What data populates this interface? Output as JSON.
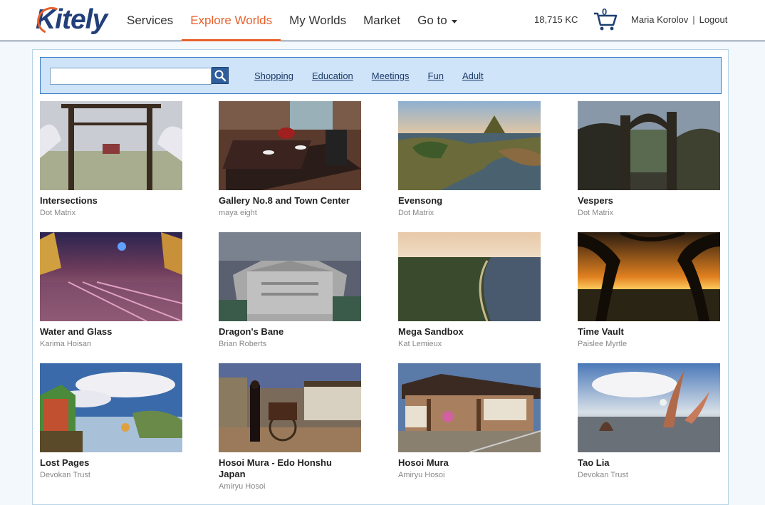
{
  "brand": {
    "logo_text": "Kitely"
  },
  "nav": {
    "items": [
      {
        "label": "Services"
      },
      {
        "label": "Explore Worlds"
      },
      {
        "label": "My Worlds"
      },
      {
        "label": "Market"
      },
      {
        "label": "Go to"
      }
    ],
    "active": "Explore Worlds"
  },
  "account": {
    "balance": "18,715 KC",
    "cart_count": "0",
    "user_name": "Maria Korolov",
    "separator": "|",
    "logout_label": "Logout"
  },
  "search": {
    "value": "",
    "placeholder": "",
    "categories": [
      "Shopping",
      "Education",
      "Meetings",
      "Fun",
      "Adult"
    ]
  },
  "worlds": [
    {
      "title": "Intersections",
      "owner": "Dot Matrix"
    },
    {
      "title": "Gallery No.8 and Town Center",
      "owner": "maya eight"
    },
    {
      "title": "Evensong",
      "owner": "Dot Matrix"
    },
    {
      "title": "Vespers",
      "owner": "Dot Matrix"
    },
    {
      "title": "Water and Glass",
      "owner": "Karima Hoisan"
    },
    {
      "title": "Dragon's Bane",
      "owner": "Brian Roberts"
    },
    {
      "title": "Mega Sandbox",
      "owner": "Kat Lemieux"
    },
    {
      "title": "Time Vault",
      "owner": "Paislee Myrtle"
    },
    {
      "title": "Lost Pages",
      "owner": "Devokan Trust"
    },
    {
      "title": "Hosoi Mura - Edo Honshu Japan",
      "owner": "Amiryu Hosoi"
    },
    {
      "title": "Hosoi Mura",
      "owner": "Amiryu Hosoi"
    },
    {
      "title": "Tao Lia",
      "owner": "Devokan Trust"
    }
  ],
  "colors": {
    "accent": "#e8602c",
    "brand": "#223f7a",
    "search_bg": "#cfe4f8"
  }
}
